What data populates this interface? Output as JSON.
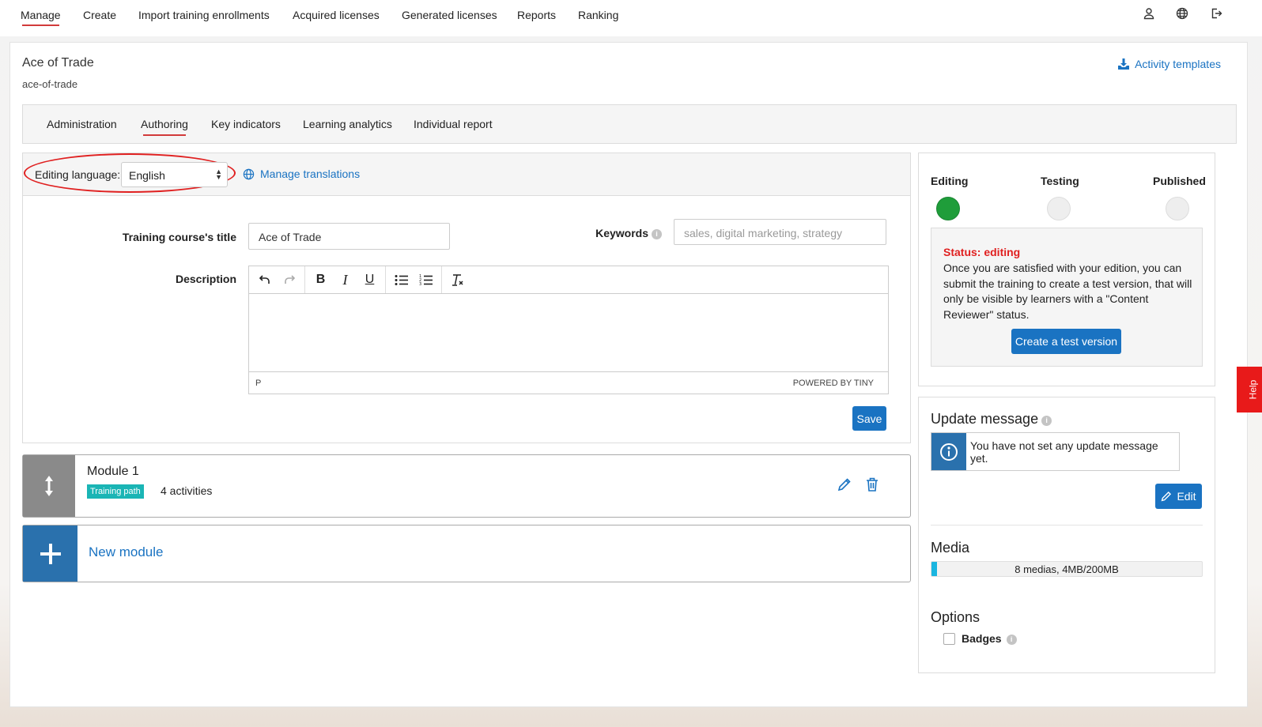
{
  "nav": {
    "items": [
      {
        "label": "Manage",
        "active": true
      },
      {
        "label": "Create"
      },
      {
        "label": "Import training enrollments"
      },
      {
        "label": "Acquired licenses"
      },
      {
        "label": "Generated licenses"
      },
      {
        "label": "Reports"
      },
      {
        "label": "Ranking"
      }
    ],
    "icons": [
      "user-icon",
      "globe-icon",
      "logout-icon"
    ]
  },
  "course": {
    "title": "Ace of Trade",
    "slug": "ace-of-trade",
    "activity_templates": "Activity templates"
  },
  "tabs": [
    {
      "label": "Administration"
    },
    {
      "label": "Authoring",
      "active": true
    },
    {
      "label": "Key indicators"
    },
    {
      "label": "Learning analytics"
    },
    {
      "label": "Individual report"
    }
  ],
  "editor": {
    "language_label": "Editing language:",
    "language_value": "English",
    "manage_translations": "Manage translations",
    "title_label": "Training course's title",
    "title_value": "Ace of Trade",
    "keywords_label": "Keywords",
    "keywords_placeholder": "sales, digital marketing, strategy",
    "description_label": "Description",
    "rte_status_path": "P",
    "rte_powered": "POWERED BY TINY",
    "save_label": "Save"
  },
  "modules": [
    {
      "name": "Module 1",
      "badge": "Training path",
      "activities": "4 activities"
    }
  ],
  "new_module_label": "New module",
  "status": {
    "steps": [
      {
        "label": "Editing",
        "state": "active",
        "color": "#1f9d3a"
      },
      {
        "label": "Testing",
        "state": "inactive",
        "color": "#eeeeee"
      },
      {
        "label": "Published",
        "state": "inactive",
        "color": "#eeeeee"
      }
    ],
    "title": "Status: editing",
    "text": "Once you are satisfied with your edition, you can submit the training to create a test version, that will only be visible by learners with a \"Content Reviewer\" status.",
    "button": "Create a test version"
  },
  "update_message": {
    "title": "Update message",
    "text": "You have not set any update message yet.",
    "edit_label": "Edit"
  },
  "media": {
    "title": "Media",
    "label": "8 medias, 4MB/200MB",
    "used_fraction": 0.02
  },
  "options": {
    "title": "Options",
    "badges_label": "Badges",
    "badges_checked": false
  },
  "help": {
    "label": "Help"
  },
  "colors": {
    "accent": "#1a73c2",
    "active_underline": "#d23a3a",
    "status_red": "#e02020",
    "badge_teal": "#1ab5b5"
  }
}
